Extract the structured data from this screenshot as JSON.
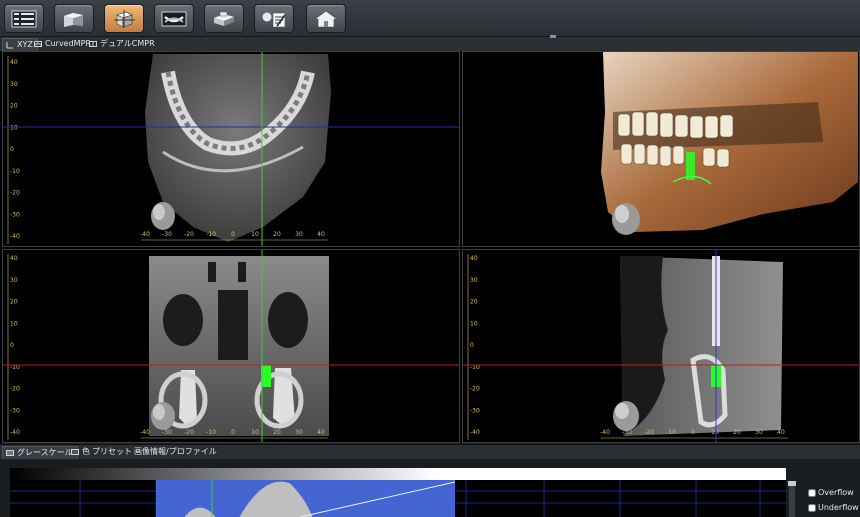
{
  "toolbar": {
    "buttons": [
      {
        "name": "layout-grid-button",
        "icon": "layout-grid-icon",
        "active": false
      },
      {
        "name": "view-cubes-button",
        "icon": "cubes-icon",
        "active": false
      },
      {
        "name": "mpr-button",
        "icon": "mpr-cube-icon",
        "active": true
      },
      {
        "name": "panorama-button",
        "icon": "panorama-jaw-icon",
        "active": false
      },
      {
        "name": "volume-render-button",
        "icon": "volume-render-icon",
        "active": false
      },
      {
        "name": "report-button",
        "icon": "head-report-icon",
        "active": false
      },
      {
        "name": "home-button",
        "icon": "home-icon",
        "active": false
      }
    ]
  },
  "tabs": [
    "XYZ",
    "CurvedMPR",
    "デュアルCMPR"
  ],
  "lower_tabs": [
    "グレースケール",
    "色",
    "プリセット",
    "画像情報/プロファイル"
  ],
  "scale_labels": {
    "horizontal": [
      "-40",
      "-30",
      "-20",
      "-10",
      "0",
      "10",
      "20",
      "30",
      "40"
    ],
    "vertical": [
      "40",
      "30",
      "20",
      "10",
      "0",
      "-10",
      "-20",
      "-30",
      "-40"
    ]
  },
  "profile": {
    "overflow_label": "Overflow",
    "underflow_label": "Underflow",
    "overflow_checked": false,
    "underflow_checked": false
  },
  "colors": {
    "toolbar_active": "#e8a55f",
    "axial_line": "#1e2fa8",
    "coronal_line": "#c21c1c",
    "sagittal_line": "#2a3ad8",
    "crosshair_green": "#3bcf3b",
    "implant_green": "#27ff27",
    "window_blue": "#4a6fe8",
    "scale_yellow": "#d8c04a"
  }
}
